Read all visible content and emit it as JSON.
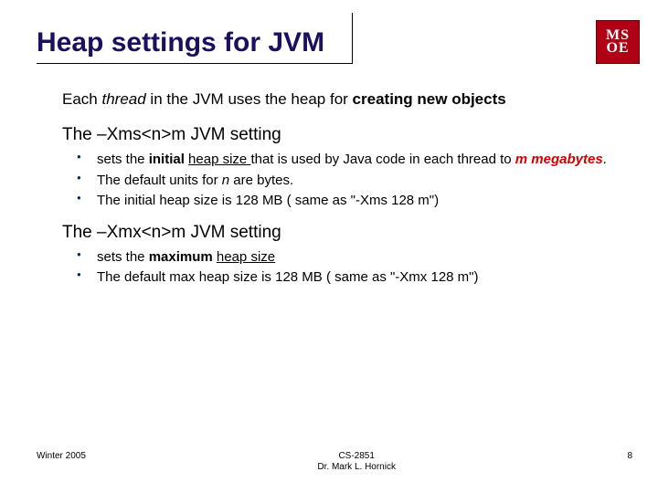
{
  "logo": {
    "line1": "MS",
    "line2": "OE"
  },
  "title": "Heap settings for JVM",
  "intro": {
    "pre": "Each ",
    "thread": "thread",
    "mid": " in the JVM uses the heap for ",
    "bold": "creating new objects"
  },
  "section1": {
    "heading": "The –Xms<n>m JVM setting",
    "items": [
      {
        "t1": "sets the ",
        "b1": "initial ",
        "u1": "heap size ",
        "t2": "that is used by Java code in each thread to ",
        "red_i_b": "m megabytes",
        "t3": "."
      },
      {
        "t1": "The default units for ",
        "i1": "n",
        "t2": " are bytes."
      },
      {
        "t1": "The initial heap size is 128 MB ( same as \"-Xms 128 m\")"
      }
    ]
  },
  "section2": {
    "heading": "The –Xmx<n>m JVM setting",
    "items": [
      {
        "t1": "sets the ",
        "b1": "maximum ",
        "u1": "heap size"
      },
      {
        "t1": "The default max heap size is 128 MB ( same as \"-Xmx 128 m\")"
      }
    ]
  },
  "footer": {
    "left": "Winter 2005",
    "center1": "CS-2851",
    "center2": "Dr. Mark L. Hornick",
    "right": "8"
  }
}
